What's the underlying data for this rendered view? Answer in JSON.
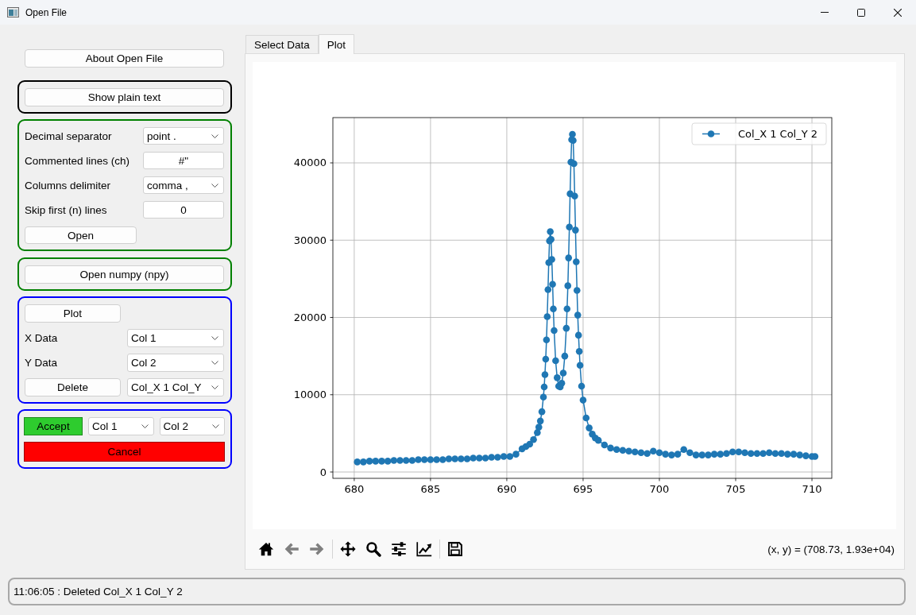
{
  "window": {
    "title": "Open File"
  },
  "sidebar": {
    "about_button": "About Open File",
    "plain_text_button": "Show plain text",
    "text_options": {
      "rows": [
        {
          "kind": "dropdown",
          "label": "Decimal separator",
          "value": "point ."
        },
        {
          "kind": "field",
          "label": "Commented lines (ch)",
          "value": "#\""
        },
        {
          "kind": "dropdown",
          "label": "Columns delimiter",
          "value": "comma ,"
        },
        {
          "kind": "field",
          "label": "Skip first (n) lines",
          "value": "0"
        }
      ],
      "open_button": "Open"
    },
    "numpy_button": "Open numpy (npy)",
    "plot_options": {
      "plot_button": "Plot",
      "x_data": {
        "label": "X Data",
        "value": "Col 1"
      },
      "y_data": {
        "label": "Y Data",
        "value": "Col 2"
      },
      "delete_button": "Delete",
      "delete_choice": "Col_X 1 Col_Y"
    },
    "accept_options": {
      "accept_button": "Accept",
      "x_choice": "Col 1",
      "y_choice": "Col 2",
      "cancel_button": "Cancel"
    }
  },
  "tabs": [
    {
      "label": "Select Data",
      "selected": false
    },
    {
      "label": "Plot",
      "selected": true
    }
  ],
  "plot": {
    "chart_data": {
      "type": "line",
      "grid": true,
      "x": [
        680.2,
        680.6,
        681.0,
        681.4,
        681.8,
        682.2,
        682.6,
        683.0,
        683.4,
        683.8,
        684.2,
        684.6,
        685.0,
        685.4,
        685.8,
        686.2,
        686.6,
        687.0,
        687.4,
        687.8,
        688.2,
        688.6,
        689.0,
        689.4,
        689.8,
        690.2,
        690.6,
        691.0,
        691.25,
        691.5,
        691.75,
        692.0,
        692.1,
        692.2,
        692.3,
        692.4,
        692.45,
        692.5,
        692.55,
        692.6,
        692.65,
        692.7,
        692.75,
        692.8,
        692.85,
        692.9,
        692.95,
        693.0,
        693.05,
        693.1,
        693.2,
        693.3,
        693.4,
        693.5,
        693.6,
        693.7,
        693.8,
        693.9,
        693.95,
        694.0,
        694.05,
        694.1,
        694.15,
        694.2,
        694.25,
        694.3,
        694.35,
        694.4,
        694.45,
        694.5,
        694.55,
        694.6,
        694.65,
        694.7,
        694.75,
        694.8,
        694.9,
        695.0,
        695.2,
        695.4,
        695.6,
        695.8,
        696.0,
        696.4,
        696.8,
        697.2,
        697.6,
        698.0,
        698.4,
        698.8,
        699.2,
        699.6,
        700.0,
        700.4,
        700.8,
        701.2,
        701.6,
        702.0,
        702.4,
        702.8,
        703.2,
        703.6,
        704.0,
        704.4,
        704.8,
        705.2,
        705.6,
        706.0,
        706.4,
        706.8,
        707.2,
        707.6,
        708.0,
        708.4,
        708.8,
        709.2,
        709.6,
        710.0,
        710.2
      ],
      "series": [
        {
          "name": "Col_X 1 Col_Y 2",
          "color": "#1f77b4",
          "marker": "o",
          "values": [
            1300,
            1300,
            1400,
            1400,
            1400,
            1400,
            1500,
            1500,
            1500,
            1500,
            1600,
            1600,
            1600,
            1600,
            1600,
            1700,
            1700,
            1700,
            1700,
            1800,
            1800,
            1800,
            1900,
            1900,
            2000,
            2000,
            2300,
            3000,
            3300,
            3600,
            4200,
            5100,
            5800,
            6600,
            7800,
            9700,
            11000,
            12600,
            14600,
            17100,
            20100,
            23600,
            27100,
            29900,
            31100,
            30100,
            27500,
            24300,
            21100,
            18300,
            14400,
            12200,
            11100,
            11000,
            11500,
            12800,
            15000,
            18600,
            21100,
            24100,
            27700,
            31700,
            36000,
            40100,
            43000,
            43700,
            42900,
            39900,
            35700,
            31300,
            27200,
            23500,
            20300,
            17700,
            15600,
            13800,
            11100,
            9300,
            7000,
            5700,
            4900,
            4400,
            4100,
            3500,
            3100,
            2900,
            2800,
            2700,
            2600,
            2500,
            2400,
            2700,
            2500,
            2300,
            2200,
            2300,
            2900,
            2500,
            2200,
            2200,
            2200,
            2300,
            2300,
            2400,
            2600,
            2600,
            2500,
            2400,
            2400,
            2400,
            2500,
            2400,
            2400,
            2300,
            2300,
            2200,
            2100,
            2000,
            2000
          ]
        }
      ],
      "xlim": [
        678.6,
        711.3
      ],
      "ylim": [
        -820,
        45860
      ],
      "xticks": [
        680,
        685,
        690,
        695,
        700,
        705,
        710
      ],
      "yticks": [
        0,
        10000,
        20000,
        30000,
        40000
      ]
    },
    "toolbar": {
      "groups": [
        {
          "buttons": [
            {
              "kind": "home",
              "disabled": false
            },
            {
              "kind": "back",
              "disabled": true
            },
            {
              "kind": "forward",
              "disabled": true
            }
          ]
        },
        {
          "buttons": [
            {
              "kind": "pan",
              "disabled": false
            },
            {
              "kind": "zoom",
              "disabled": false
            },
            {
              "kind": "subplots",
              "disabled": false
            },
            {
              "kind": "customize",
              "disabled": false
            }
          ]
        },
        {
          "buttons": [
            {
              "kind": "save",
              "disabled": false
            }
          ]
        }
      ],
      "coordinates": "(x, y) = (708.73, 1.93e+04)"
    }
  },
  "status_bar": {
    "message": "11:06:05 : Deleted Col_X 1 Col_Y 2"
  }
}
